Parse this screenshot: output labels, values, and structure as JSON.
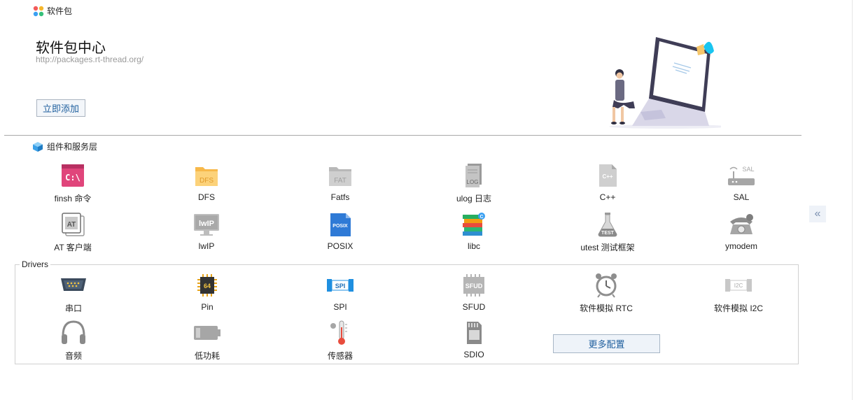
{
  "header": {
    "title": "软件包"
  },
  "package_center": {
    "title": "软件包中心",
    "url": "http://packages.rt-thread.org/",
    "add_button": "立即添加"
  },
  "components": {
    "title": "组件和服务层",
    "items": [
      {
        "label": "finsh 命令",
        "icon": "terminal-icon"
      },
      {
        "label": "DFS",
        "icon": "folder-icon"
      },
      {
        "label": "Fatfs",
        "icon": "fat-folder-icon"
      },
      {
        "label": "ulog 日志",
        "icon": "log-file-icon"
      },
      {
        "label": "C++",
        "icon": "cpp-file-icon"
      },
      {
        "label": "SAL",
        "icon": "router-icon"
      },
      {
        "label": "AT 客户端",
        "icon": "at-icon"
      },
      {
        "label": "lwIP",
        "icon": "monitor-icon"
      },
      {
        "label": "POSIX",
        "icon": "posix-doc-icon"
      },
      {
        "label": "libc",
        "icon": "books-icon"
      },
      {
        "label": "utest 测试框架",
        "icon": "flask-icon"
      },
      {
        "label": "ymodem",
        "icon": "telephone-icon"
      }
    ]
  },
  "drivers": {
    "title": "Drivers",
    "items": [
      {
        "label": "串口",
        "icon": "serial-port-icon"
      },
      {
        "label": "Pin",
        "icon": "chip-icon"
      },
      {
        "label": "SPI",
        "icon": "spi-icon"
      },
      {
        "label": "SFUD",
        "icon": "sfud-chip-icon"
      },
      {
        "label": "软件模拟 RTC",
        "icon": "alarm-clock-icon"
      },
      {
        "label": "软件模拟 I2C",
        "icon": "i2c-icon"
      },
      {
        "label": "音频",
        "icon": "headphones-icon"
      },
      {
        "label": "低功耗",
        "icon": "battery-icon"
      },
      {
        "label": "传感器",
        "icon": "thermometer-icon"
      },
      {
        "label": "SDIO",
        "icon": "sd-card-icon"
      }
    ],
    "more_button": "更多配置"
  },
  "side": {
    "collapse_glyph": "«"
  }
}
